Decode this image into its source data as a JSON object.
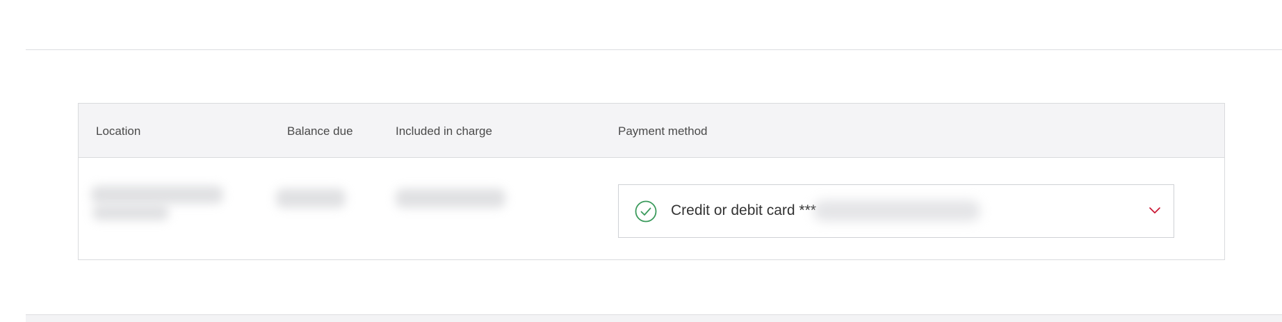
{
  "table": {
    "headers": {
      "location": "Location",
      "balance_due": "Balance due",
      "included_in_charge": "Included in charge",
      "payment_method": "Payment method"
    },
    "rows": [
      {
        "payment_method": {
          "selected_label": "Credit or debit card ***",
          "status_icon": "check-circle-icon",
          "dropdown_icon": "chevron-down-icon"
        }
      }
    ]
  },
  "colors": {
    "success_green": "#3a9a5b",
    "accent_red": "#c8102e",
    "header_background": "#f4f4f6",
    "border": "#d9dadd"
  }
}
